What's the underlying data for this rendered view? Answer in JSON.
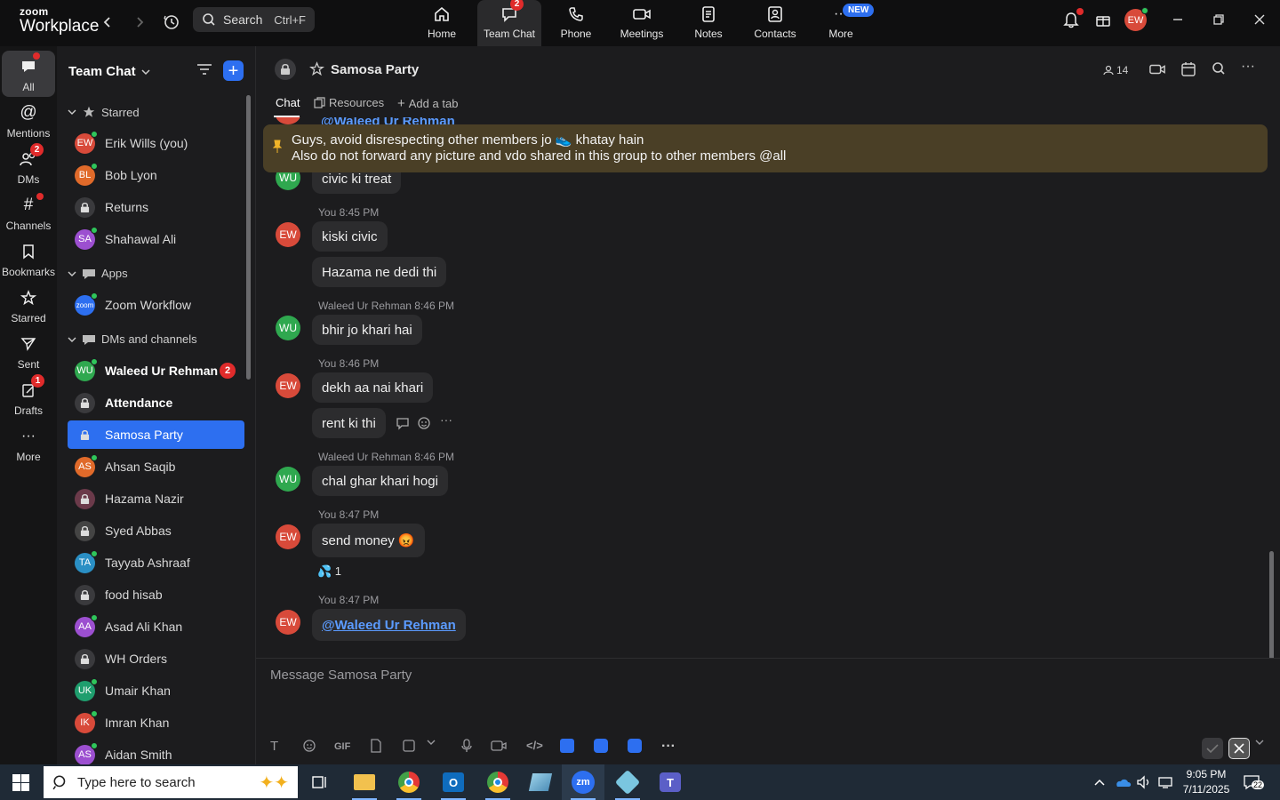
{
  "topbar": {
    "logo_small": "zoom",
    "logo_big": "Workplace",
    "search_label": "Search",
    "search_shortcut": "Ctrl+F",
    "nav": [
      {
        "label": "Home",
        "badge": ""
      },
      {
        "label": "Team Chat",
        "badge": "2"
      },
      {
        "label": "Phone",
        "badge": ""
      },
      {
        "label": "Meetings",
        "badge": ""
      },
      {
        "label": "Notes",
        "badge": ""
      },
      {
        "label": "Contacts",
        "badge": ""
      },
      {
        "label": "More",
        "badge": "NEW"
      }
    ],
    "avatar_initials": "EW"
  },
  "rail": [
    {
      "label": "All",
      "badge": ""
    },
    {
      "label": "Mentions",
      "badge": ""
    },
    {
      "label": "DMs",
      "badge": "2"
    },
    {
      "label": "Channels",
      "badge": ""
    },
    {
      "label": "Bookmarks",
      "badge": ""
    },
    {
      "label": "Starred",
      "badge": ""
    },
    {
      "label": "Sent",
      "badge": ""
    },
    {
      "label": "Drafts",
      "badge": "1"
    },
    {
      "label": "More",
      "badge": ""
    }
  ],
  "sidebar": {
    "title": "Team Chat",
    "sections": {
      "starred": "Starred",
      "apps": "Apps",
      "dms": "DMs and channels"
    },
    "starred": [
      {
        "label": "Erik Wills (you)",
        "initials": "EW",
        "color": "#d84a3a"
      },
      {
        "label": "Bob Lyon",
        "initials": "BL",
        "color": "#e06a2a"
      },
      {
        "label": "Returns",
        "initials": "",
        "color": "#3a3a3d"
      },
      {
        "label": "Shahawal Ali",
        "initials": "SA",
        "color": "#9c4fd0"
      }
    ],
    "apps": [
      {
        "label": "Zoom Workflow",
        "initials": "zoom",
        "color": "#2d6ff0"
      }
    ],
    "dms": [
      {
        "label": "Waleed Ur Rehman",
        "initials": "WU",
        "color": "#2fa84f",
        "count": "2"
      },
      {
        "label": "Attendance",
        "initials": "",
        "color": "#3a3a3d",
        "count": ""
      },
      {
        "label": "Samosa Party",
        "initials": "",
        "color": "#2d6ff0",
        "count": ""
      },
      {
        "label": "Ahsan Saqib",
        "initials": "AS",
        "color": "#e06a2a",
        "count": ""
      },
      {
        "label": "Hazama Nazir",
        "initials": "",
        "color": "#6b3a4a",
        "count": ""
      },
      {
        "label": "Syed Abbas",
        "initials": "",
        "color": "#444",
        "count": ""
      },
      {
        "label": "Tayyab Ashraaf",
        "initials": "TA",
        "color": "#2a8fc4",
        "count": ""
      },
      {
        "label": "food hisab",
        "initials": "",
        "color": "#3a3a3d",
        "count": ""
      },
      {
        "label": "Asad Ali Khan",
        "initials": "AA",
        "color": "#9c4fd0",
        "count": ""
      },
      {
        "label": "WH Orders",
        "initials": "",
        "color": "#3a3a3d",
        "count": ""
      },
      {
        "label": "Umair Khan",
        "initials": "UK",
        "color": "#1f9e6e",
        "count": ""
      },
      {
        "label": "Imran Khan",
        "initials": "IK",
        "color": "#d84a3a",
        "count": ""
      },
      {
        "label": "Aidan Smith",
        "initials": "AS",
        "color": "#9c4fd0",
        "count": ""
      }
    ]
  },
  "channel": {
    "name": "Samosa Party",
    "members": "14",
    "tabs": [
      "Chat",
      "Resources",
      "Add a tab"
    ],
    "pinned_line1": "Guys, avoid disrespecting other members jo 👟 khatay hain",
    "pinned_line2": "Also do not forward any picture and vdo shared in this group to other members @all",
    "messages": [
      {
        "meta": "",
        "initials": "WU",
        "color": "#2fa84f",
        "text": "civic ki treat"
      },
      {
        "meta": "You 8:45 PM",
        "initials": "EW",
        "color": "#d84a3a",
        "text": "kiski civic"
      },
      {
        "meta": "",
        "initials": "",
        "color": "",
        "text": "Hazama ne dedi thi"
      },
      {
        "meta": "Waleed Ur Rehman 8:46 PM",
        "initials": "WU",
        "color": "#2fa84f",
        "text": "bhir jo khari hai"
      },
      {
        "meta": "You 8:46 PM",
        "initials": "EW",
        "color": "#d84a3a",
        "text": "dekh aa nai khari"
      },
      {
        "meta": "",
        "initials": "",
        "color": "",
        "text": "rent ki thi"
      },
      {
        "meta": "Waleed Ur Rehman 8:46 PM",
        "initials": "WU",
        "color": "#2fa84f",
        "text": "chal ghar khari hogi"
      },
      {
        "meta": "You 8:47 PM",
        "initials": "EW",
        "color": "#d84a3a",
        "text": "send money 😡"
      },
      {
        "meta": "You 8:47 PM",
        "initials": "EW",
        "color": "#d84a3a",
        "text": "@Waleed Ur Rehman"
      }
    ],
    "top_cut_mention": "@Waleed Ur Rehman",
    "reaction": "💦 1",
    "composer_placeholder": "Message Samosa Party"
  },
  "taskbar": {
    "search_placeholder": "Type here to search",
    "time": "9:05 PM",
    "date": "7/11/2025",
    "notif_count": "22"
  }
}
